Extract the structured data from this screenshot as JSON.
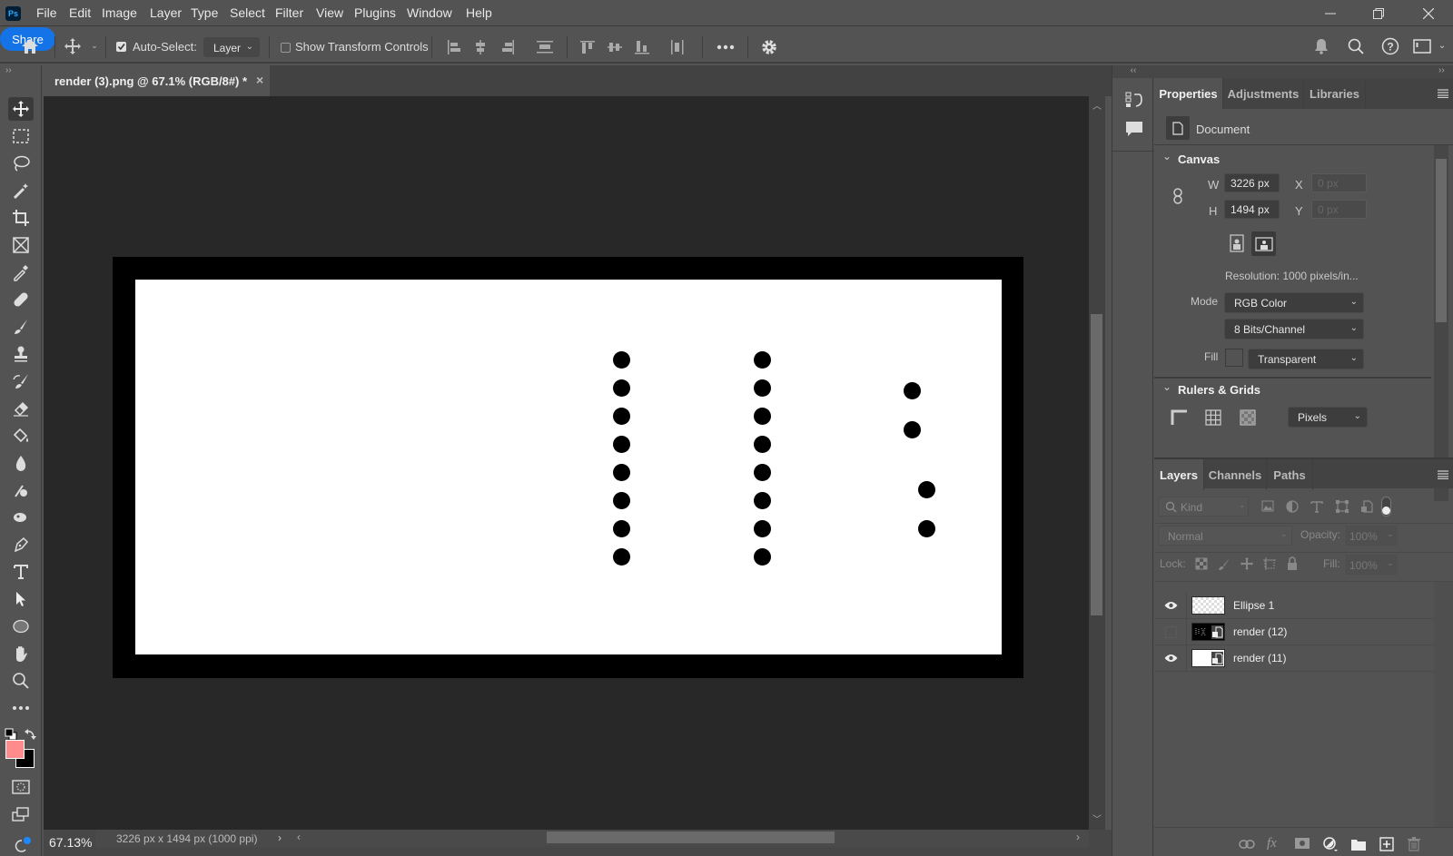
{
  "app": {
    "logo": "Ps"
  },
  "menu": [
    "File",
    "Edit",
    "Image",
    "Layer",
    "Type",
    "Select",
    "Filter",
    "View",
    "Plugins",
    "Window",
    "Help"
  ],
  "options_bar": {
    "auto_select_label": "Auto-Select:",
    "auto_select_checked": true,
    "auto_select_target": "Layer",
    "show_transform_label": "Show Transform Controls",
    "show_transform_checked": false,
    "share_label": "Share"
  },
  "document": {
    "tab_title": "render (3).png @ 67.1% (RGB/8#) *",
    "zoom": "67.13%",
    "status_info": "3226 px x 1494 px (1000 ppi)"
  },
  "colors": {
    "foreground": "#ff8c8c",
    "background": "#000000",
    "accent": "#1473e6"
  },
  "properties": {
    "tabs": [
      "Properties",
      "Adjustments",
      "Libraries"
    ],
    "active_tab": "Properties",
    "doc_label": "Document",
    "canvas_header": "Canvas",
    "w_label": "W",
    "w_value": "3226 px",
    "h_label": "H",
    "h_value": "1494 px",
    "x_label": "X",
    "x_value": "0 px",
    "y_label": "Y",
    "y_value": "0 px",
    "resolution": "Resolution: 1000 pixels/in...",
    "mode_label": "Mode",
    "mode_value": "RGB Color",
    "bits_value": "8 Bits/Channel",
    "fill_label": "Fill",
    "fill_value": "Transparent",
    "rulers_header": "Rulers & Grids",
    "units_value": "Pixels"
  },
  "layers_panel": {
    "tabs": [
      "Layers",
      "Channels",
      "Paths"
    ],
    "active_tab": "Layers",
    "filter_placeholder": "Kind",
    "blend_mode": "Normal",
    "opacity_label": "Opacity:",
    "opacity_value": "100%",
    "lock_label": "Lock:",
    "fill_label": "Fill:",
    "fill_value": "100%",
    "layers": [
      {
        "name": "Ellipse 1",
        "visible": true
      },
      {
        "name": "render (12)",
        "visible": false
      },
      {
        "name": "render (11)",
        "visible": true
      }
    ]
  }
}
